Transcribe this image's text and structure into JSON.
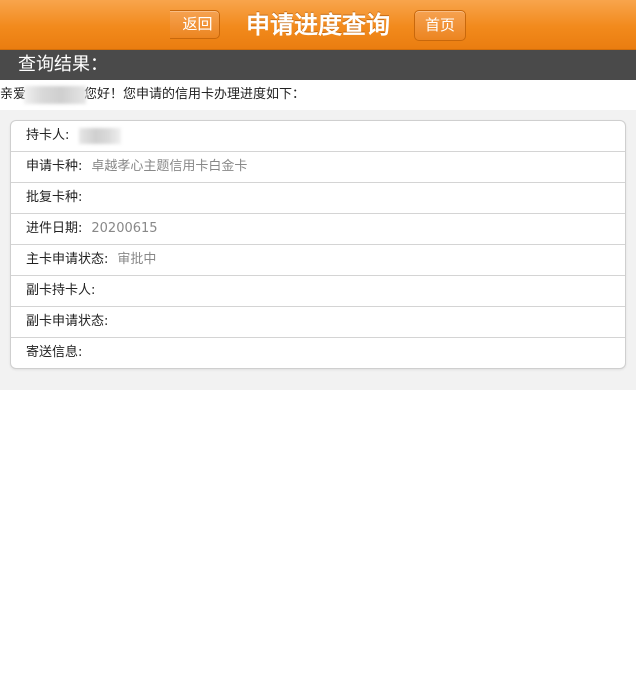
{
  "header": {
    "title": "申请进度查询",
    "back_label": "返回",
    "home_label": "首页"
  },
  "section": {
    "title": "查询结果："
  },
  "greeting": {
    "prefix": "亲爱",
    "suffix": "您好！您申请的信用卡办理进度如下："
  },
  "details": {
    "rows": [
      {
        "label": "持卡人:",
        "value": ""
      },
      {
        "label": "申请卡种:",
        "value": "卓越孝心主题信用卡白金卡"
      },
      {
        "label": "批复卡种:",
        "value": ""
      },
      {
        "label": "进件日期:",
        "value": "20200615"
      },
      {
        "label": "主卡申请状态:",
        "value": "审批中"
      },
      {
        "label": "副卡持卡人:",
        "value": ""
      },
      {
        "label": "副卡申请状态:",
        "value": ""
      },
      {
        "label": "寄送信息:",
        "value": ""
      }
    ]
  },
  "colors": {
    "header_orange": "#f28a1c",
    "section_bar": "#4a4a4a",
    "value_gray": "#888888"
  }
}
